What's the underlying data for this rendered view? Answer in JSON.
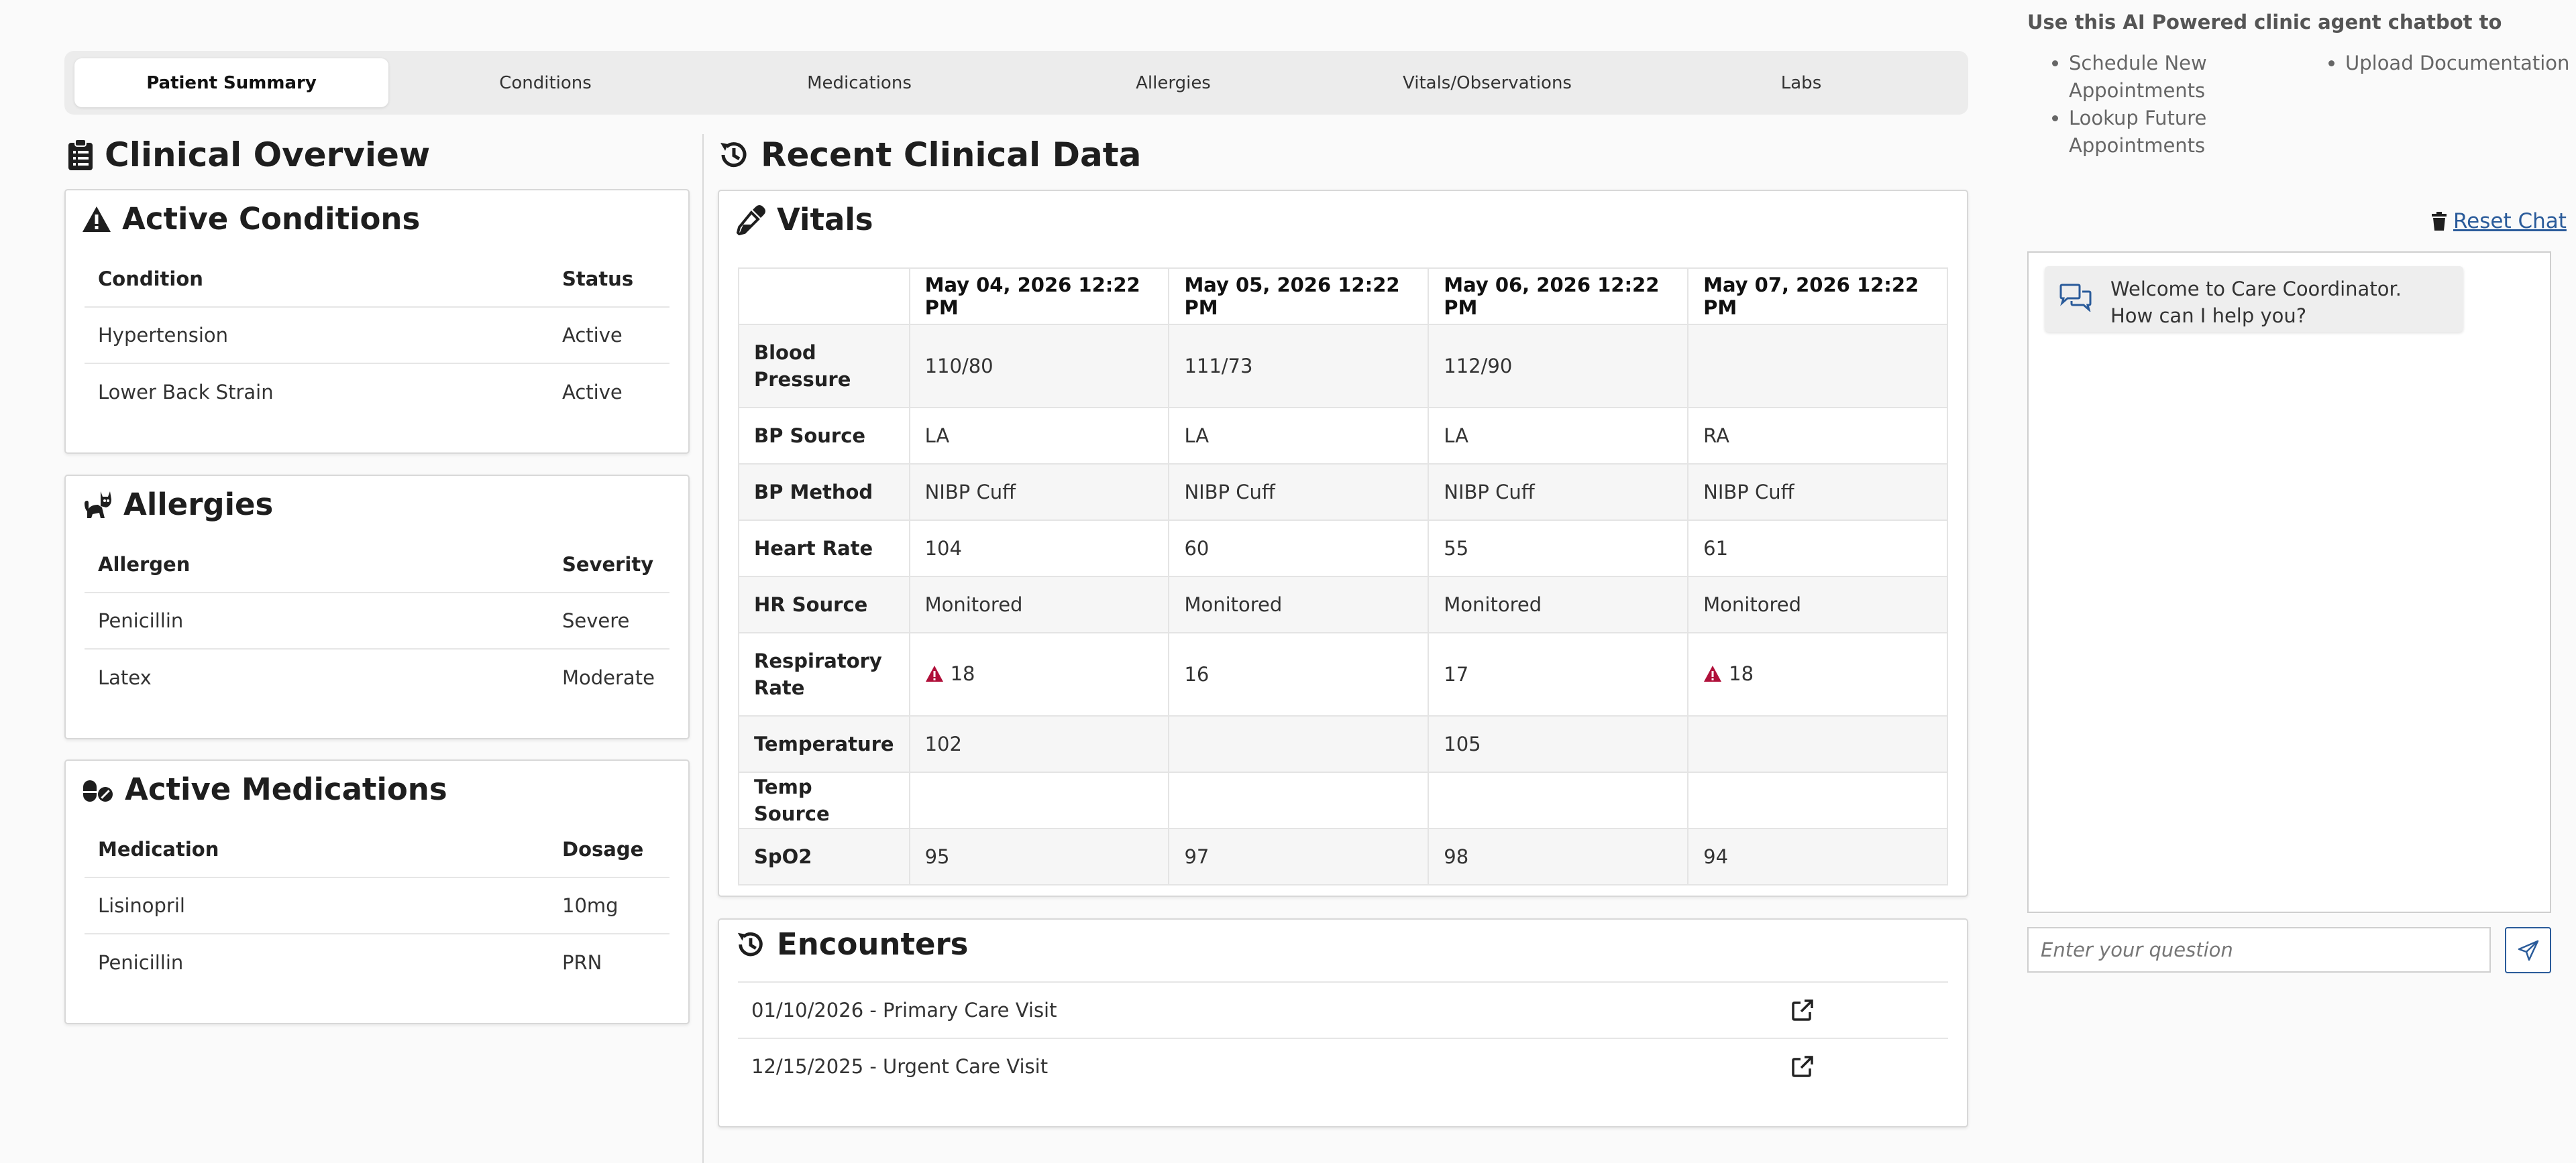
{
  "tabs": [
    {
      "label": "Patient Summary",
      "active": true
    },
    {
      "label": "Conditions"
    },
    {
      "label": "Medications"
    },
    {
      "label": "Allergies"
    },
    {
      "label": "Vitals/Observations"
    },
    {
      "label": "Labs"
    }
  ],
  "clinical_overview": {
    "title": "Clinical Overview",
    "active_conditions": {
      "title": "Active Conditions",
      "columns": [
        "Condition",
        "Status"
      ],
      "rows": [
        [
          "Hypertension",
          "Active"
        ],
        [
          "Lower Back Strain",
          "Active"
        ]
      ]
    },
    "allergies": {
      "title": "Allergies",
      "columns": [
        "Allergen",
        "Severity"
      ],
      "rows": [
        [
          "Penicillin",
          "Severe"
        ],
        [
          "Latex",
          "Moderate"
        ]
      ]
    },
    "active_medications": {
      "title": "Active Medications",
      "columns": [
        "Medication",
        "Dosage"
      ],
      "rows": [
        [
          "Lisinopril",
          "10mg"
        ],
        [
          "Penicillin",
          "PRN"
        ]
      ]
    }
  },
  "recent_data": {
    "title": "Recent Clinical Data",
    "vitals": {
      "title": "Vitals",
      "dates": [
        "May 04, 2026 12:22 PM",
        "May 05, 2026 12:22 PM",
        "May 06, 2026 12:22 PM",
        "May 07, 2026 12:22 PM"
      ],
      "rows": [
        {
          "label": "Blood Pressure",
          "values": [
            "110/80",
            "111/73",
            "112/90",
            ""
          ]
        },
        {
          "label": "BP Source",
          "values": [
            "LA",
            "LA",
            "LA",
            "RA"
          ]
        },
        {
          "label": "BP Method",
          "values": [
            "NIBP Cuff",
            "NIBP Cuff",
            "NIBP Cuff",
            "NIBP Cuff"
          ]
        },
        {
          "label": "Heart Rate",
          "values": [
            "104",
            "60",
            "55",
            "61"
          ]
        },
        {
          "label": "HR Source",
          "values": [
            "Monitored",
            "Monitored",
            "Monitored",
            "Monitored"
          ]
        },
        {
          "label": "Respiratory Rate",
          "values": [
            "18",
            "16",
            "17",
            "18"
          ],
          "warn": [
            true,
            false,
            false,
            true
          ]
        },
        {
          "label": "Temperature",
          "values": [
            "102",
            "",
            "105",
            ""
          ]
        },
        {
          "label": "Temp Source",
          "values": [
            "",
            "",
            "",
            ""
          ]
        },
        {
          "label": "SpO2",
          "values": [
            "95",
            "97",
            "98",
            "94"
          ]
        }
      ]
    },
    "encounters": {
      "title": "Encounters",
      "items": [
        "01/10/2026 - Primary Care Visit",
        "12/15/2025 - Urgent Care Visit"
      ]
    }
  },
  "chat": {
    "heading": "Use this AI Powered clinic agent chatbot to",
    "bullets_left": [
      "Schedule New Appointments",
      "Lookup Future Appointments"
    ],
    "bullets_right": [
      "Upload Documentation"
    ],
    "reset_label": "Reset Chat",
    "welcome": "Welcome to Care Coordinator.  How can I help you?",
    "placeholder": "Enter your question"
  },
  "colors": {
    "accent": "#2a5b9a",
    "warning": "#b0103a"
  }
}
